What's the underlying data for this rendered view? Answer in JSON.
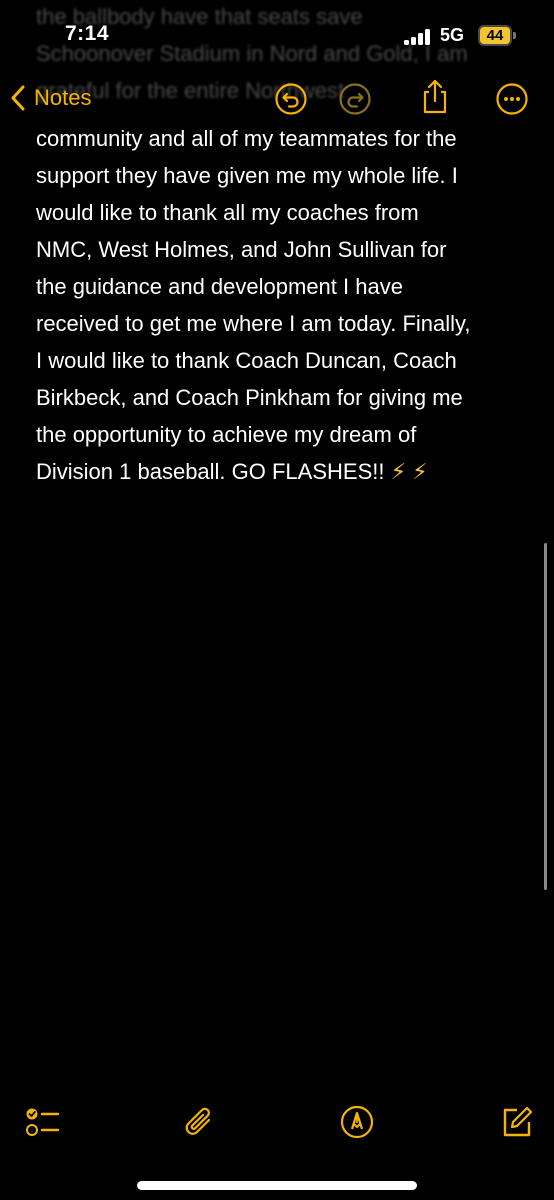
{
  "status_bar": {
    "time": "7:14",
    "network": "5G",
    "battery_level": "44"
  },
  "nav": {
    "back_label": "Notes",
    "icons": [
      "chevron-left-icon",
      "undo-icon",
      "redo-icon",
      "share-icon",
      "more-icon"
    ]
  },
  "faded_lines": [
    "the ballbody have that seats save",
    "Schoonover Stadium in Nord and Gold, I am",
    "grateful for the entire Northwest"
  ],
  "note": {
    "lines": [
      "community and all of my teammates for the",
      "support they have given me my whole life. I",
      "would like to thank all my coaches from",
      "NMC, West Holmes, and John Sullivan for",
      "the guidance and development I have",
      "received to get me where I am today. Finally,",
      "I would like to thank Coach Duncan, Coach",
      "Birkbeck, and Coach Pinkham for giving me",
      "the opportunity to achieve my dream of",
      "Division 1 baseball. GO FLASHES!!"
    ],
    "emoji": "⚡ ⚡"
  },
  "toolbar": {
    "icons": [
      "checklist-icon",
      "paperclip-icon",
      "markup-pen-icon",
      "compose-icon"
    ]
  },
  "colors": {
    "accent": "#f4b400",
    "background": "#000000",
    "text": "#ffffff"
  }
}
